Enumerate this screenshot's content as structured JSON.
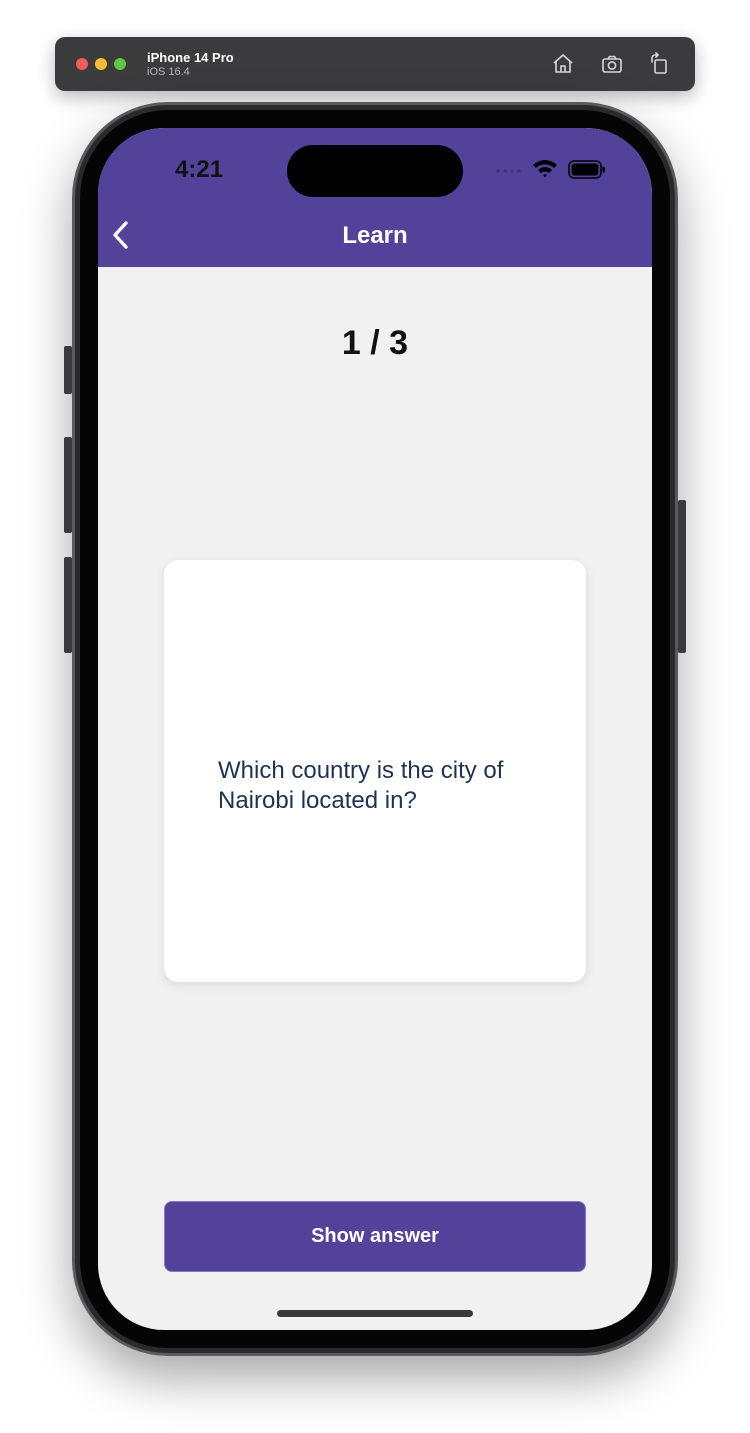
{
  "simulator": {
    "device_name": "iPhone 14 Pro",
    "os_version": "iOS 16.4",
    "icons": [
      "home-icon",
      "screenshot-icon",
      "rotate-icon"
    ]
  },
  "status_bar": {
    "time": "4:21"
  },
  "nav": {
    "title": "Learn",
    "back_icon": "chevron-left-icon",
    "color": "#524299"
  },
  "flashcard": {
    "progress": "1 / 3",
    "question": "Which country is the city of Nairobi located in?"
  },
  "actions": {
    "show_answer_label": "Show answer"
  }
}
